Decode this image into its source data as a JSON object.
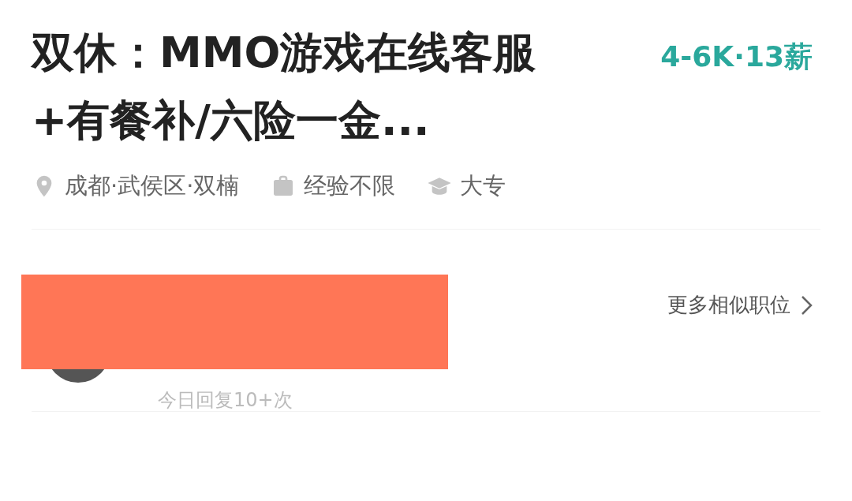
{
  "job": {
    "title": "双休：MMO游戏在线客服+有餐补/六险一金...",
    "salary": "4-6K·13薪"
  },
  "meta": [
    {
      "kind": "location",
      "text": "成都·武侯区·双楠"
    },
    {
      "kind": "experience",
      "text": "经验不限"
    },
    {
      "kind": "education",
      "text": "大专"
    }
  ],
  "recruiter": {
    "reply_rate": "今日回复10+次",
    "redacted": true
  },
  "more_link": {
    "label": "更多相似职位"
  }
}
